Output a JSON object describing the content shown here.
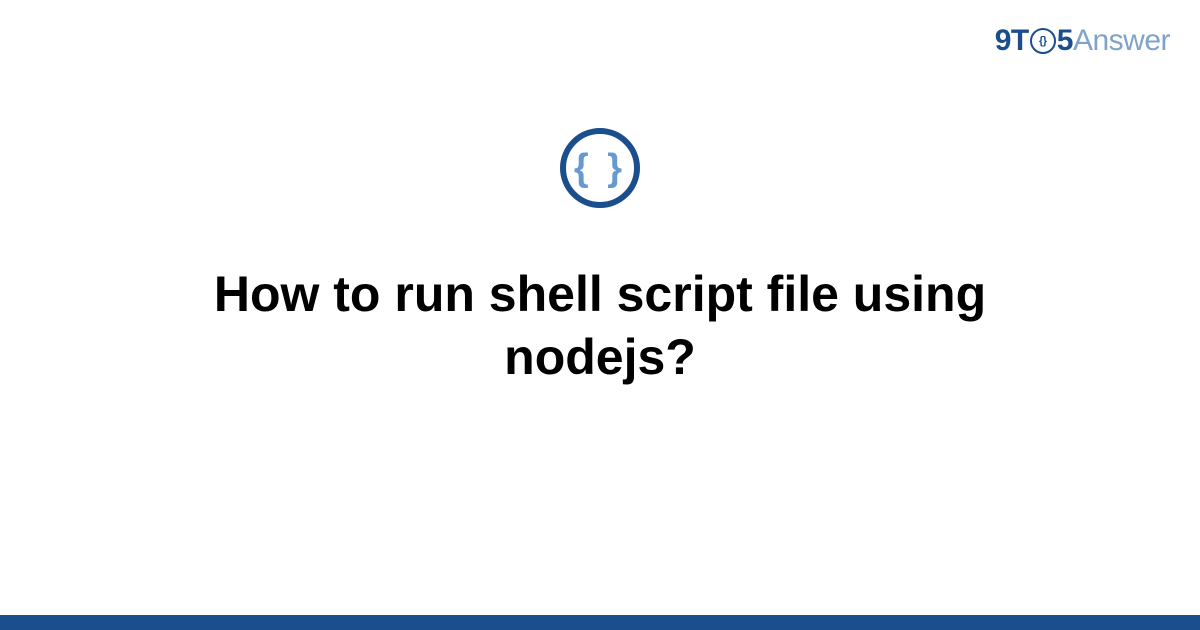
{
  "brand": {
    "part1": "9T",
    "clock_text": "{}",
    "part2": "5",
    "part3": "Answer"
  },
  "icon": {
    "name": "code-braces-icon",
    "glyph": "{ }"
  },
  "title": "How to run shell script file using nodejs?",
  "colors": {
    "primary": "#1b4e8c",
    "secondary": "#7fa3c9",
    "icon_brace": "#6599d0"
  }
}
